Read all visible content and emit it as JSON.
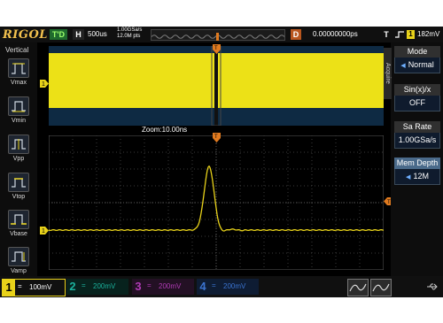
{
  "topbar": {
    "brand": "RIGOL",
    "trigger_status": "T'D",
    "horizontal_mode": "H",
    "timebase": "500us",
    "sample_rate": "1.00GSa/s",
    "memory_depth": "12.0M pts",
    "delay_mode": "D",
    "delay_value": "0.00000000ps",
    "trigger_mode": "T",
    "trigger_edge_icon": "rising-edge-icon",
    "trigger_source": "1",
    "trigger_level": "182mV"
  },
  "left": {
    "title": "Vertical",
    "items": [
      {
        "label": "Vmax",
        "icon": "vmax-icon"
      },
      {
        "label": "Vmin",
        "icon": "vmin-icon"
      },
      {
        "label": "Vpp",
        "icon": "vpp-icon"
      },
      {
        "label": "Vtop",
        "icon": "vtop-icon"
      },
      {
        "label": "Vbase",
        "icon": "vbase-icon"
      },
      {
        "label": "Vamp",
        "icon": "vamp-icon"
      }
    ]
  },
  "zoom": {
    "label": "Zoom:10.00ns"
  },
  "markers": {
    "channel1": "1",
    "trigger_position": "T",
    "trigger_level": "T"
  },
  "right_menu": {
    "tab": "Acquire",
    "items": [
      {
        "title": "Mode",
        "value": "Normal",
        "has_arrow": true
      },
      {
        "title": "Sin(x)/x",
        "value": "OFF",
        "has_arrow": false
      },
      {
        "title": "Sa Rate",
        "value": "1.00GSa/s",
        "has_arrow": false
      },
      {
        "title": "Mem Depth",
        "value": "12M",
        "has_arrow": true
      }
    ]
  },
  "channels": [
    {
      "num": "1",
      "coupling": "=",
      "scale": "100mV",
      "color": "#e8d21a"
    },
    {
      "num": "2",
      "coupling": "=",
      "scale": "200mV",
      "color": "#1bb19c"
    },
    {
      "num": "3",
      "coupling": "=",
      "scale": "200mV",
      "color": "#b03bb5"
    },
    {
      "num": "4",
      "coupling": "=",
      "scale": "200mV",
      "color": "#3b74d1"
    }
  ],
  "colors": {
    "ch1": "#e8d21a",
    "trigger": "#e07a1f",
    "zoom_background": "#0e2a43",
    "menu_selected": "#4a6a8a"
  }
}
